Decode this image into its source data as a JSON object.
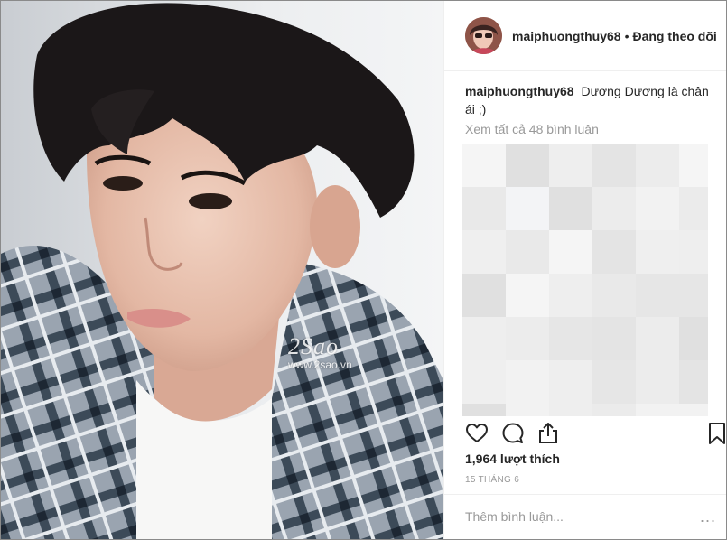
{
  "post": {
    "watermark_logo": "2Sao",
    "watermark_url": "www.2sao.vn"
  },
  "header": {
    "username": "maiphuongthuy68",
    "separator": "•",
    "follow_label": "Đang theo dõi"
  },
  "caption": {
    "username": "maiphuongthuy68",
    "text": "Dương Dương là chân ái ;)"
  },
  "comments": {
    "view_all_label": "Xem tất cả 48 bình luận"
  },
  "actions": {
    "like_icon": "heart-icon",
    "comment_icon": "comment-icon",
    "share_icon": "share-icon",
    "save_icon": "bookmark-icon"
  },
  "likes": {
    "label": "1,964 lượt thích"
  },
  "date": {
    "label": "15 THÁNG 6"
  },
  "comment_box": {
    "placeholder": "Thêm bình luận...",
    "more_label": "..."
  },
  "colors": {
    "text": "#262626",
    "muted": "#999999",
    "divider": "#efefef"
  }
}
